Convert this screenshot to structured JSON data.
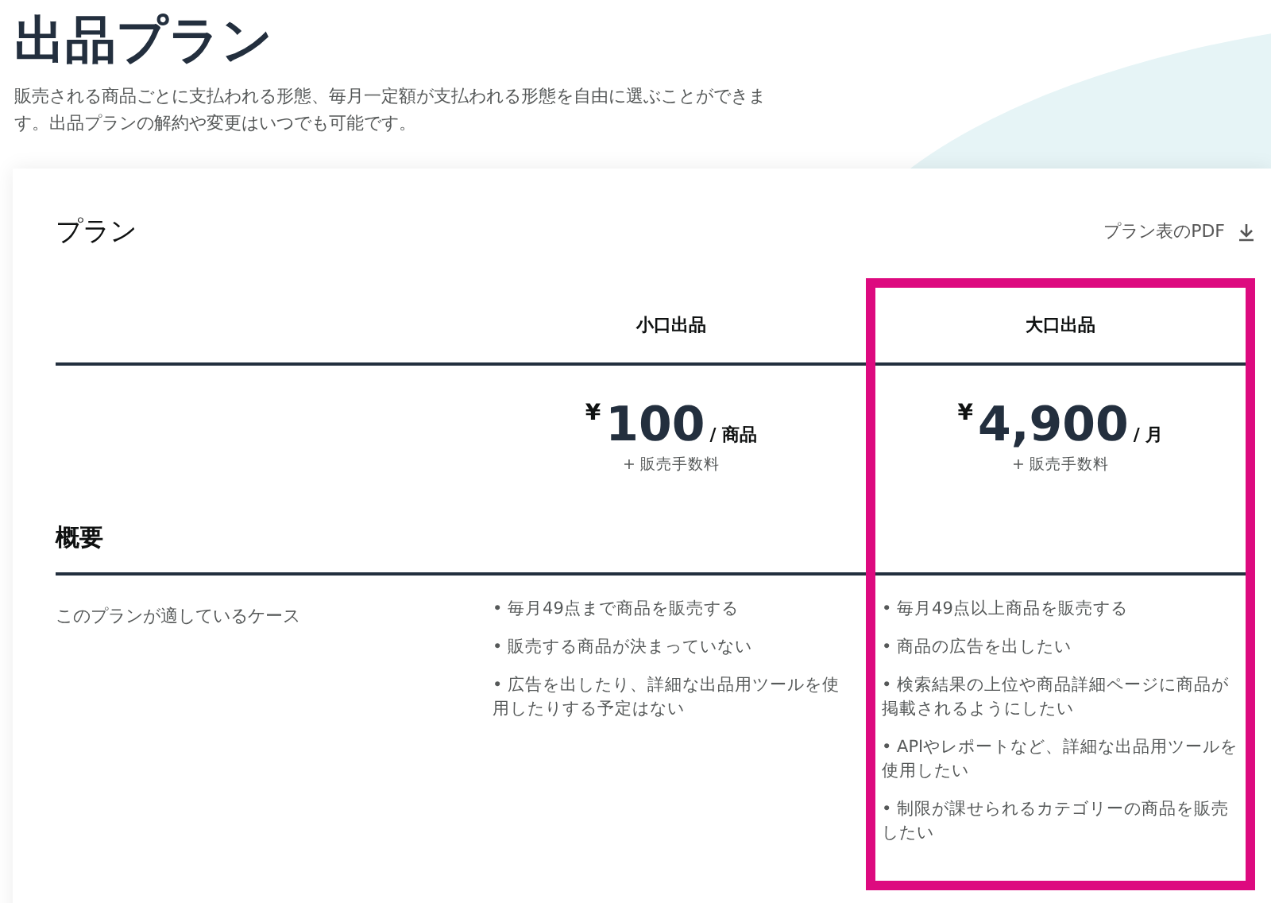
{
  "header": {
    "title": "出品プラン",
    "description": "販売される商品ごとに支払われる形態、毎月一定額が支払われる形態を自由に選ぶことができます。出品プランの解約や変更はいつでも可能です。"
  },
  "card": {
    "title": "プラン",
    "pdf_link": "プラン表のPDF",
    "plans": [
      {
        "name": "小口出品",
        "currency": "¥",
        "price": "100",
        "unit": "/ 商品",
        "fee": "+ 販売手数料",
        "highlighted": false
      },
      {
        "name": "大口出品",
        "currency": "¥",
        "price": "4,900",
        "unit": "/ 月",
        "fee": "+ 販売手数料",
        "highlighted": true
      }
    ],
    "section_title": "概要",
    "rows": [
      {
        "label": "このプランが適しているケース",
        "cells": [
          [
            "• 毎月49点まで商品を販売する",
            "• 販売する商品が決まっていない",
            "• 広告を出したり、詳細な出品用ツールを使用したりする予定はない"
          ],
          [
            "• 毎月49点以上商品を販売する",
            "• 商品の広告を出したい",
            "• 検索結果の上位や商品詳細ページに商品が掲載されるようにしたい",
            "• APIやレポートなど、詳細な出品用ツールを使用したい",
            "• 制限が課せられるカテゴリーの商品を販売したい"
          ]
        ]
      }
    ]
  }
}
